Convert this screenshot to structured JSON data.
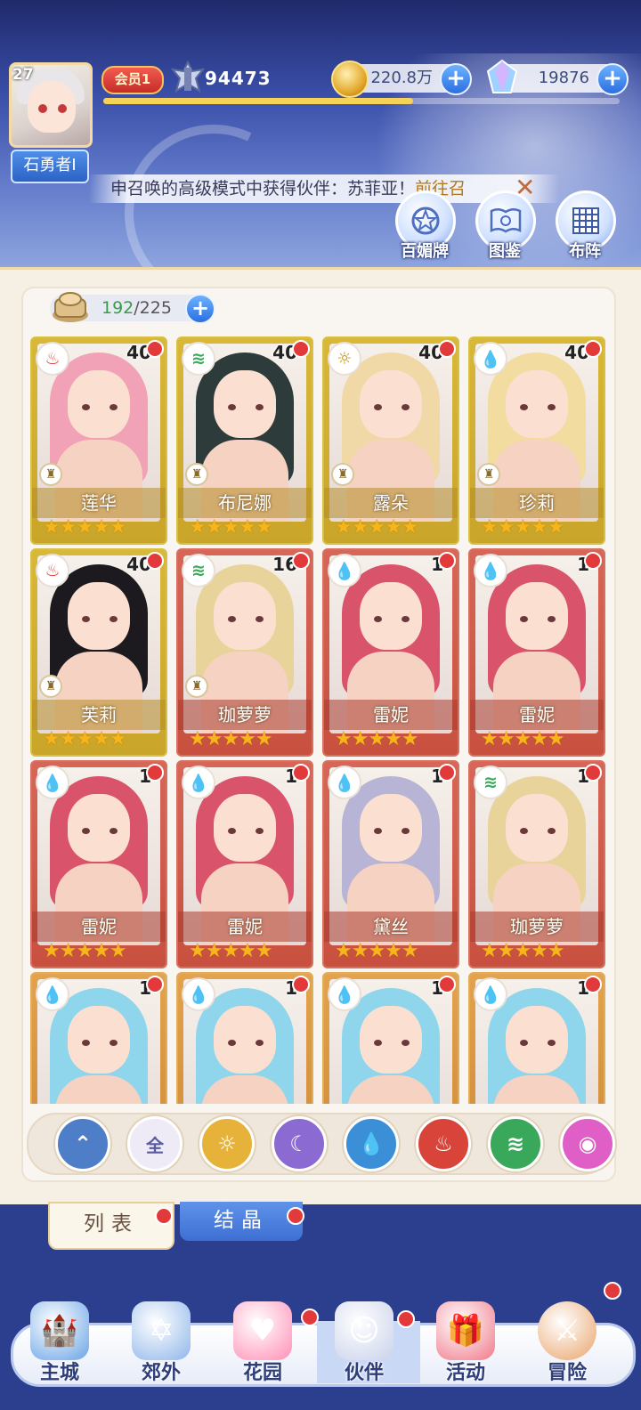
{
  "player": {
    "level": "27",
    "name": "石勇者I",
    "vip": "会员1",
    "power": "94473",
    "xp_progress": 0.6
  },
  "resources": {
    "gold": "220.8万",
    "gems": "19876"
  },
  "ticker": {
    "text": "申召唤的高级模式中获得伙伴：苏菲亚！",
    "link": "前往召"
  },
  "header_buttons": [
    {
      "label": "百媚牌",
      "icon": "card-star-icon"
    },
    {
      "label": "图鉴",
      "icon": "book-icon"
    },
    {
      "label": "布阵",
      "icon": "grid-formation-icon"
    }
  ],
  "capacity": {
    "current": "192",
    "max": "/225"
  },
  "cards": [
    {
      "name": "莲华",
      "level": "40",
      "element": "fire",
      "rarity": "gold",
      "stars": "★★★★★",
      "hair": "#f2a2b6",
      "rank": true
    },
    {
      "name": "布尼娜",
      "level": "40",
      "element": "wind",
      "rarity": "gold",
      "stars": "★★★★★",
      "hair": "#2d3b3a",
      "rank": true
    },
    {
      "name": "露朵",
      "level": "40",
      "element": "light",
      "rarity": "gold",
      "stars": "★★★★★",
      "hair": "#f0d9a6",
      "rank": true
    },
    {
      "name": "珍莉",
      "level": "40",
      "element": "water",
      "rarity": "gold",
      "stars": "★★★★★",
      "hair": "#f2dca0",
      "rank": true
    },
    {
      "name": "芙莉",
      "level": "40",
      "element": "fire",
      "rarity": "gold",
      "stars": "★★★★★",
      "hair": "#1c1a1f",
      "rank": true
    },
    {
      "name": "珈萝萝",
      "level": "16",
      "element": "wind",
      "rarity": "red",
      "stars": "★★★★★",
      "hair": "#e8d39a",
      "rank": true
    },
    {
      "name": "雷妮",
      "level": "1",
      "element": "water",
      "rarity": "red",
      "stars": "★★★★★",
      "hair": "#d9536a",
      "rank": false
    },
    {
      "name": "雷妮",
      "level": "1",
      "element": "water",
      "rarity": "red",
      "stars": "★★★★★",
      "hair": "#d9536a",
      "rank": false
    },
    {
      "name": "雷妮",
      "level": "1",
      "element": "water",
      "rarity": "red",
      "stars": "★★★★★",
      "hair": "#d9536a",
      "rank": false
    },
    {
      "name": "雷妮",
      "level": "1",
      "element": "water",
      "rarity": "red",
      "stars": "★★★★★",
      "hair": "#d9536a",
      "rank": false
    },
    {
      "name": "黛丝",
      "level": "1",
      "element": "water",
      "rarity": "red",
      "stars": "★★★★★",
      "hair": "#b8b4d6",
      "rank": false
    },
    {
      "name": "珈萝萝",
      "level": "1",
      "element": "wind",
      "rarity": "red",
      "stars": "★★★★★",
      "hair": "#e8d39a",
      "rank": false
    },
    {
      "name": "",
      "level": "1",
      "element": "water",
      "rarity": "orange",
      "stars": "",
      "hair": "#8fd6ec",
      "rank": false
    },
    {
      "name": "",
      "level": "1",
      "element": "water",
      "rarity": "orange",
      "stars": "",
      "hair": "#8fd6ec",
      "rank": false
    },
    {
      "name": "",
      "level": "1",
      "element": "water",
      "rarity": "orange",
      "stars": "",
      "hair": "#8fd6ec",
      "rank": false
    },
    {
      "name": "",
      "level": "1",
      "element": "water",
      "rarity": "orange",
      "stars": "",
      "hair": "#8fd6ec",
      "rank": false
    }
  ],
  "filters": [
    {
      "id": "collapse",
      "label": "",
      "icon": "collapse-arrow-icon",
      "color": "#4f7ec9"
    },
    {
      "id": "all",
      "label": "全",
      "icon": "all-icon",
      "color": "#eeeaf6"
    },
    {
      "id": "light",
      "label": "",
      "icon": "sun-icon",
      "color": "#e6b23a"
    },
    {
      "id": "dark",
      "label": "",
      "icon": "moon-icon",
      "color": "#8b6ad1"
    },
    {
      "id": "water",
      "label": "",
      "icon": "water-drop-icon",
      "color": "#3b8fd6"
    },
    {
      "id": "fire",
      "label": "",
      "icon": "flame-icon",
      "color": "#d9443a"
    },
    {
      "id": "wind",
      "label": "",
      "icon": "wind-icon",
      "color": "#3aa85a"
    },
    {
      "id": "star",
      "label": "",
      "icon": "planet-icon",
      "color": "#e05fc6"
    }
  ],
  "tabs": {
    "list": "列表",
    "crystal": "结晶"
  },
  "nav": [
    {
      "label": "主城",
      "icon": "castle-icon"
    },
    {
      "label": "郊外",
      "icon": "portal-icon"
    },
    {
      "label": "花园",
      "icon": "heart-icon"
    },
    {
      "label": "伙伴",
      "icon": "partner-icon"
    },
    {
      "label": "活动",
      "icon": "gift-icon"
    },
    {
      "label": "冒险",
      "icon": "sword-icon"
    }
  ]
}
